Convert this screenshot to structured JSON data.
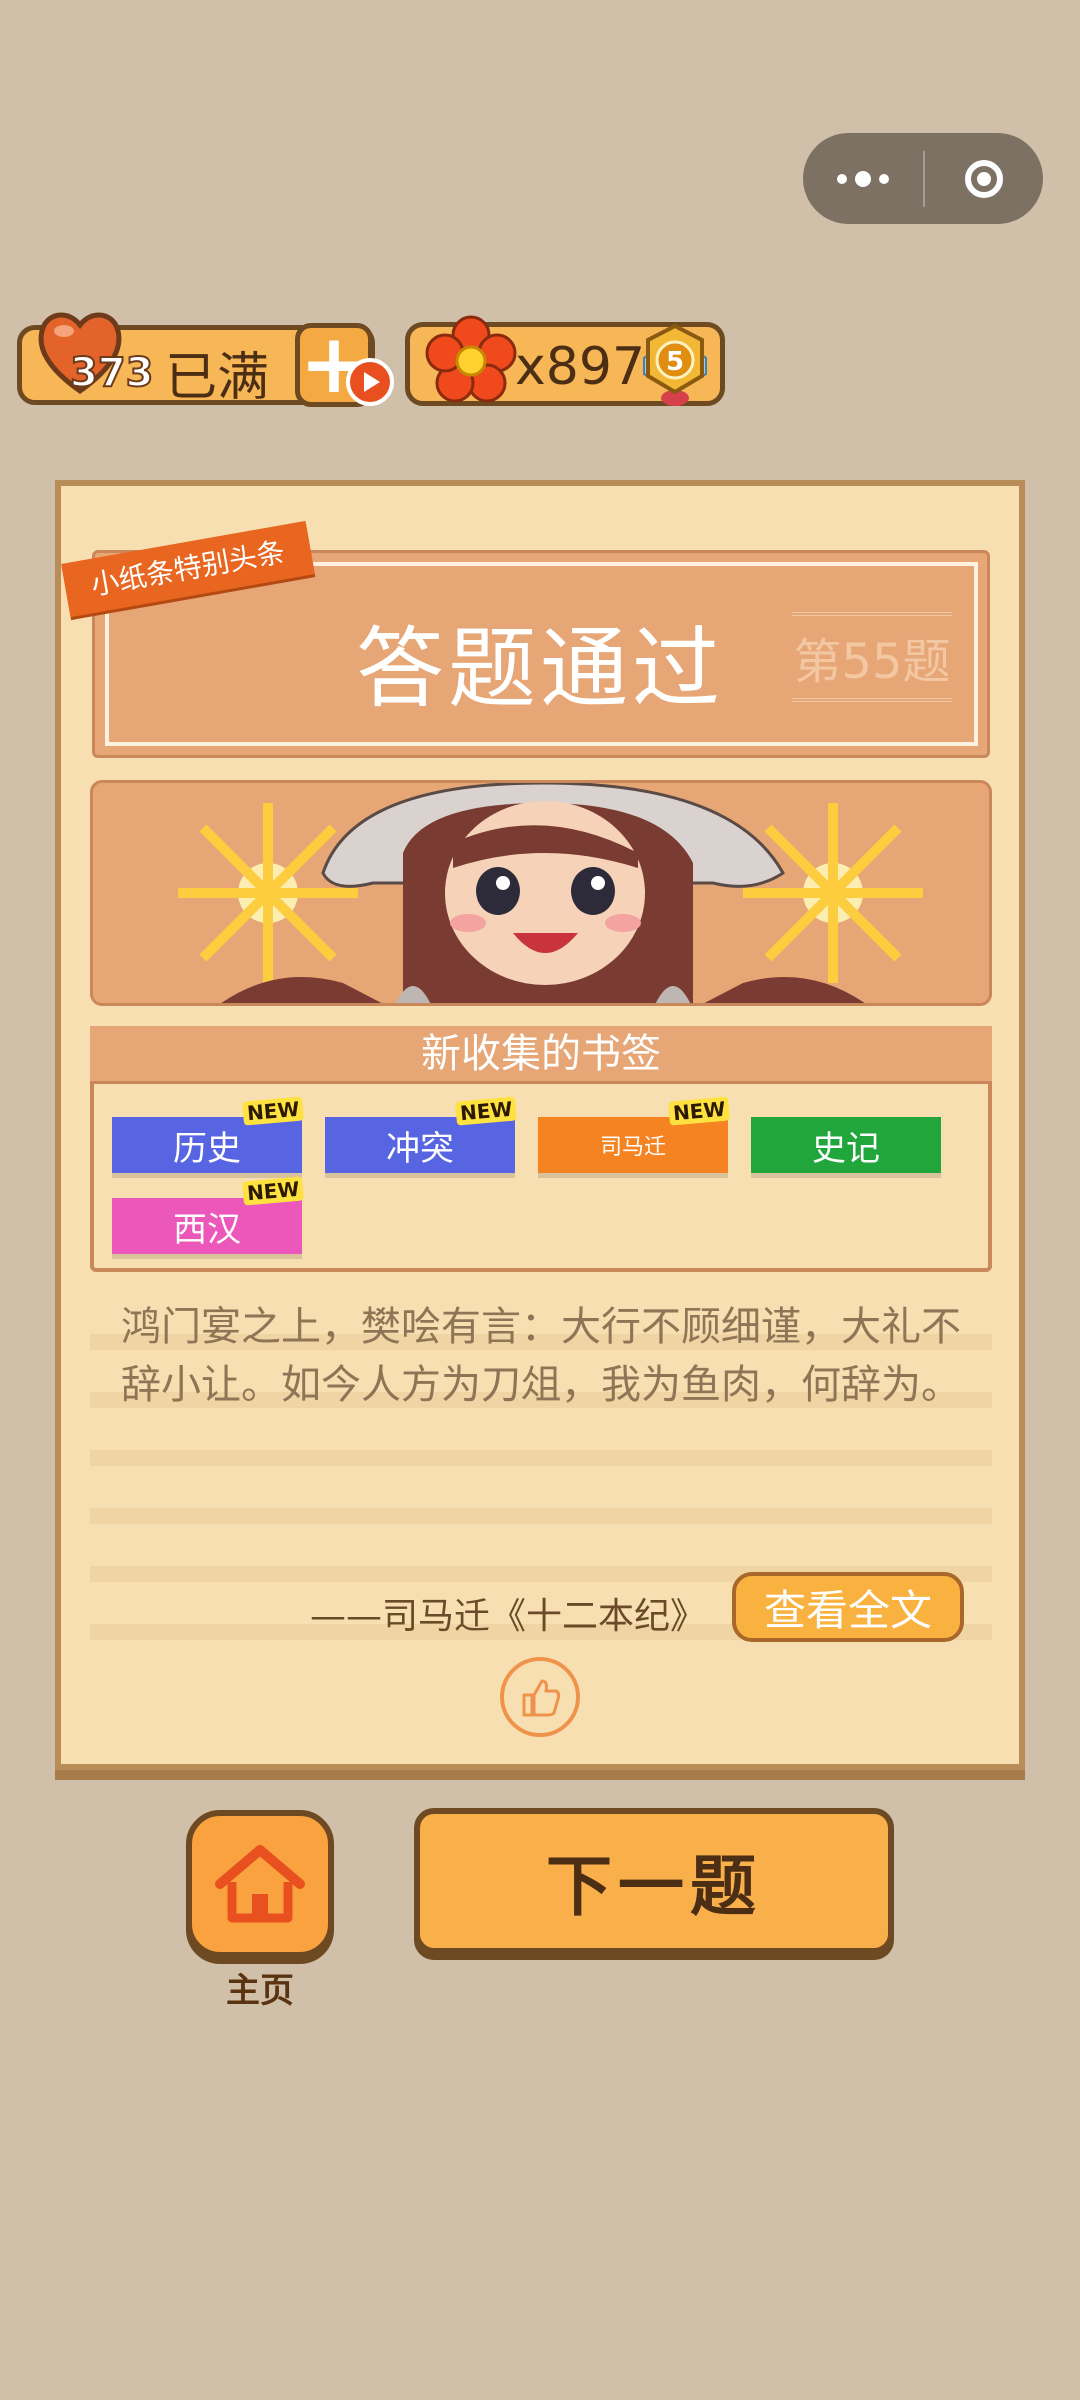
{
  "hearts": {
    "count": "373",
    "status": "已满"
  },
  "flowers": {
    "count": "x897",
    "level_badge": "5"
  },
  "card": {
    "ribbon": "小纸条特别头条",
    "title": "答题通过",
    "level": "第55题",
    "bookmark_heading": "新收集的书签",
    "new_label": "NEW",
    "tags": [
      {
        "label": "历史",
        "color": "#5765e3",
        "is_new": true
      },
      {
        "label": "冲突",
        "color": "#5765e3",
        "is_new": true
      },
      {
        "label": "司马迁",
        "color": "#f58322",
        "is_new": true
      },
      {
        "label": "史记",
        "color": "#21a63c",
        "is_new": false
      },
      {
        "label": "西汉",
        "color": "#ec58ba",
        "is_new": true
      }
    ],
    "quote": "鸿门宴之上，樊哙有言：大行不顾细谨，大礼不辞小让。如今人方为刀俎，我为鱼肉，何辞为。",
    "source": "——司马迁《十二本纪》",
    "view_full_button": "查看全文"
  },
  "footer": {
    "home_label": "主页",
    "next_button": "下一题"
  },
  "colors": {
    "background": "#d0c0a9",
    "paper": "#f8dfb2",
    "accent": "#e6a676",
    "button": "#f9b04b"
  },
  "icons": [
    "more-icon",
    "close-target-icon",
    "heart-icon",
    "plus-icon",
    "play-icon",
    "flower-icon",
    "level-badge-icon",
    "thumbs-up-icon",
    "home-icon"
  ]
}
